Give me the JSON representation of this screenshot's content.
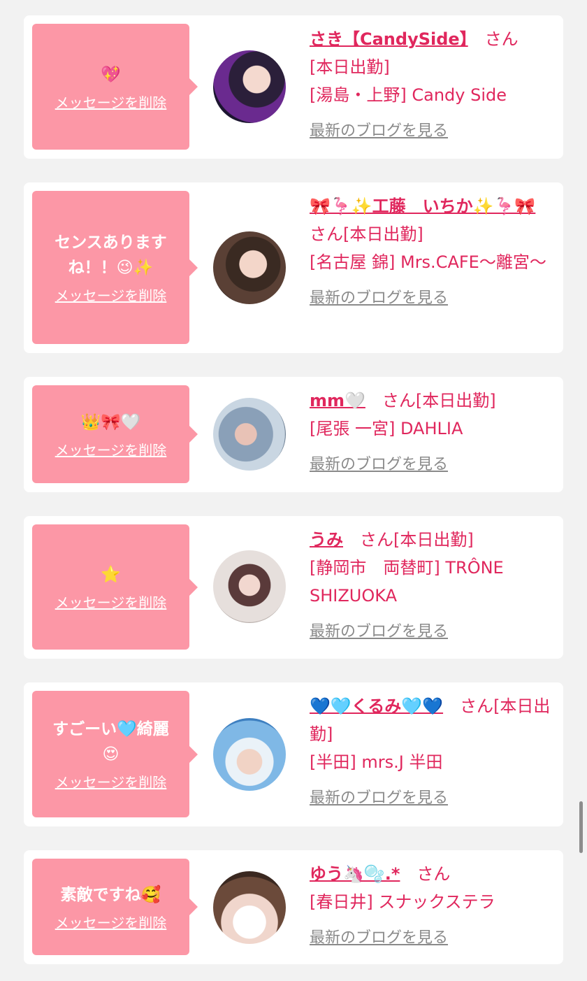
{
  "delete_label": "メッセージを削除",
  "blog_label": "最新のブログを見る",
  "san_label": "さん",
  "items": [
    {
      "message": "💖",
      "name": "さき【CandySide】",
      "status": "[本日出勤]",
      "shop": "[湯島・上野] Candy Side"
    },
    {
      "message": "センスあります\nね！！😉✨",
      "name": "🎀🦩✨工藤　いちか✨🦩🎀",
      "status": "[本日出勤]",
      "shop": "[名古屋 錦] Mrs.CAFE〜離宮〜"
    },
    {
      "message": "👑🎀🤍",
      "name": "mm🤍",
      "status": "[本日出勤]",
      "shop": "[尾張 一宮] DAHLIA"
    },
    {
      "message": "⭐",
      "name": "うみ",
      "status": "[本日出勤]",
      "shop": "[静岡市　両替町] TRÔNE SHIZUOKA"
    },
    {
      "message": "すごーい🩵綺麗\n😍",
      "name": "💙🩵くるみ🩵💙",
      "status": "[本日出勤]",
      "shop": "[半田] mrs.J 半田"
    },
    {
      "message": "素敵ですね🥰",
      "name": "ゆう🦄🫧.*",
      "status": "",
      "shop": "[春日井] スナックステラ"
    }
  ],
  "colors": {
    "background": "#f2f2f2",
    "card": "#ffffff",
    "bubble": "#fc97a6",
    "name_pink": "#e0275d",
    "blog_gray": "#8a8a8a"
  }
}
